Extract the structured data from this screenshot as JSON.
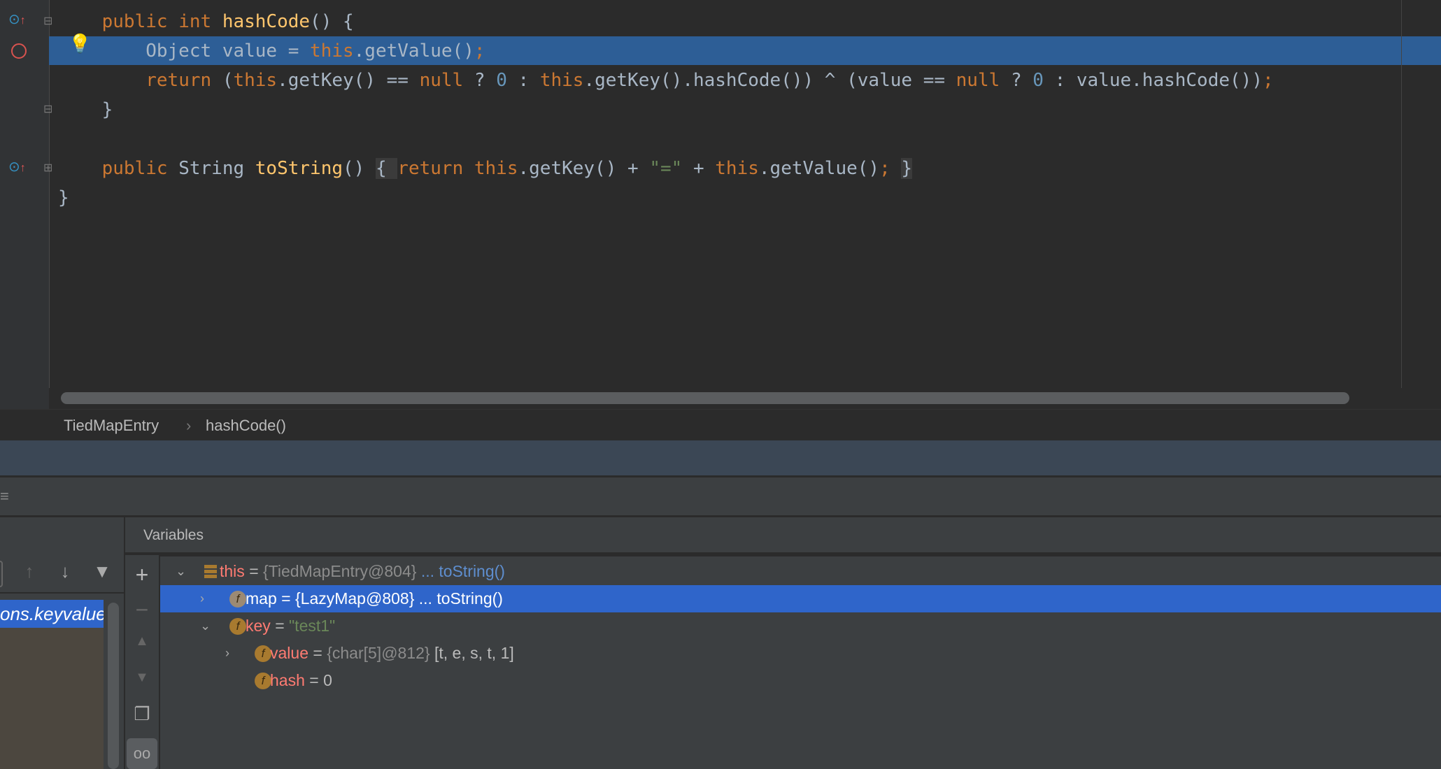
{
  "editor": {
    "lines": [
      [
        [
          "    ",
          "d"
        ],
        [
          "public int ",
          "k"
        ],
        [
          "hashCode",
          "m"
        ],
        [
          "() {",
          "d"
        ]
      ],
      [
        [
          "        Object value = ",
          "d"
        ],
        [
          "this",
          "k"
        ],
        [
          ".getValue()",
          "d"
        ],
        [
          ";",
          "k"
        ]
      ],
      [
        [
          "        ",
          "d"
        ],
        [
          "return ",
          "k"
        ],
        [
          "(",
          "d"
        ],
        [
          "this",
          "k"
        ],
        [
          ".getKey() == ",
          "d"
        ],
        [
          "null ",
          "k"
        ],
        [
          "? ",
          "d"
        ],
        [
          "0 ",
          "n"
        ],
        [
          ": ",
          "d"
        ],
        [
          "this",
          "k"
        ],
        [
          ".getKey().hashCode()) ^ (value == ",
          "d"
        ],
        [
          "null ",
          "k"
        ],
        [
          "? ",
          "d"
        ],
        [
          "0 ",
          "n"
        ],
        [
          ": value.hashCode())",
          "d"
        ],
        [
          ";",
          "k"
        ]
      ],
      [
        [
          "    }",
          "d"
        ]
      ],
      [],
      [
        [
          "    ",
          "d"
        ],
        [
          "public ",
          "k"
        ],
        [
          "String ",
          "d"
        ],
        [
          "toString",
          "m"
        ],
        [
          "() ",
          "d"
        ],
        [
          "{ ",
          "fold"
        ],
        [
          "return this",
          "k"
        ],
        [
          ".getKey() + ",
          "d"
        ],
        [
          "\"=\"",
          "s"
        ],
        [
          " + ",
          "d"
        ],
        [
          "this",
          "k"
        ],
        [
          ".getValue()",
          "d"
        ],
        [
          ";",
          "k"
        ],
        [
          " ",
          "d"
        ],
        [
          "}",
          "fold"
        ]
      ],
      [
        [
          "}",
          "d"
        ]
      ]
    ]
  },
  "breadcrumb": {
    "items": [
      "TiedMapEntry",
      "hashCode()"
    ],
    "separator": "›"
  },
  "frames": {
    "selected": "ons.keyvalue"
  },
  "variables": {
    "header": "Variables",
    "rows": [
      {
        "name": "this",
        "eq": "=",
        "value": "{TiedMapEntry@804}",
        "extra": "... toString()",
        "expanded": true
      },
      {
        "name": "map",
        "eq": "=",
        "value": "{LazyMap@808}",
        "extra": "... toString()",
        "expanded": false,
        "selected": true
      },
      {
        "name": "key",
        "eq": "=",
        "value": "\"test1\"",
        "expanded": true
      },
      {
        "name": "value",
        "eq": "=",
        "value": "{char[5]@812}",
        "extra": "[t, e, s, t, 1]",
        "expanded": false
      },
      {
        "name": "hash",
        "eq": "=",
        "value": "0"
      }
    ]
  },
  "colors": {
    "keyword": "#cc7832",
    "method": "#ffc66d",
    "selection": "#2f65ca",
    "exec_line": "#2d5e96"
  }
}
